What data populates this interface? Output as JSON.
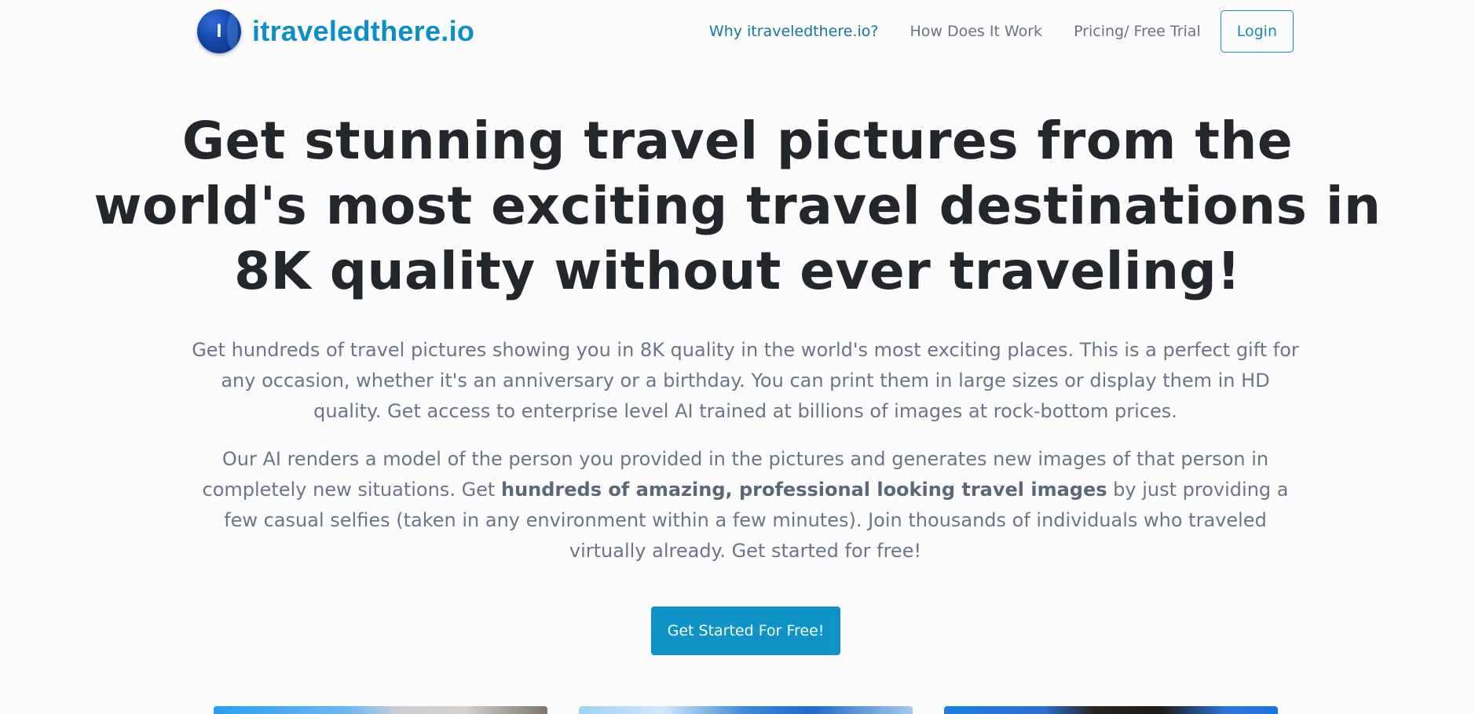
{
  "header": {
    "logo_letter": "I",
    "brand_name": "itraveledthere.io",
    "nav": [
      {
        "label": "Why itraveledthere.io?"
      },
      {
        "label": "How Does It Work"
      },
      {
        "label": "Pricing/ Free Trial"
      }
    ],
    "login_label": "Login"
  },
  "hero": {
    "title": "Get stunning travel pictures from the world's most exciting travel destinations in 8K quality without ever traveling!",
    "paragraph1": "Get hundreds of travel pictures showing you in 8K quality in the world's most exciting places. This is a perfect gift for any occasion, whether it's an anniversary or a birthday. You can print them in large sizes or display them in HD quality. Get access to enterprise level AI trained at billions of images at rock-bottom prices.",
    "paragraph2_before": "Our AI renders a model of the person you provided in the pictures and generates new images of that person in completely new situations. Get ",
    "paragraph2_bold": "hundreds of amazing, professional looking travel images",
    "paragraph2_after": " by just providing a few casual selfies (taken in any environment within a few minutes). Join thousands of individuals who traveled virtually already. Get started for free!",
    "cta_label": "Get Started For Free!"
  },
  "colors": {
    "brand": "#0b8fc7",
    "cta": "#0f93c6",
    "title_text": "#23262b",
    "body_text": "#6c7585"
  }
}
